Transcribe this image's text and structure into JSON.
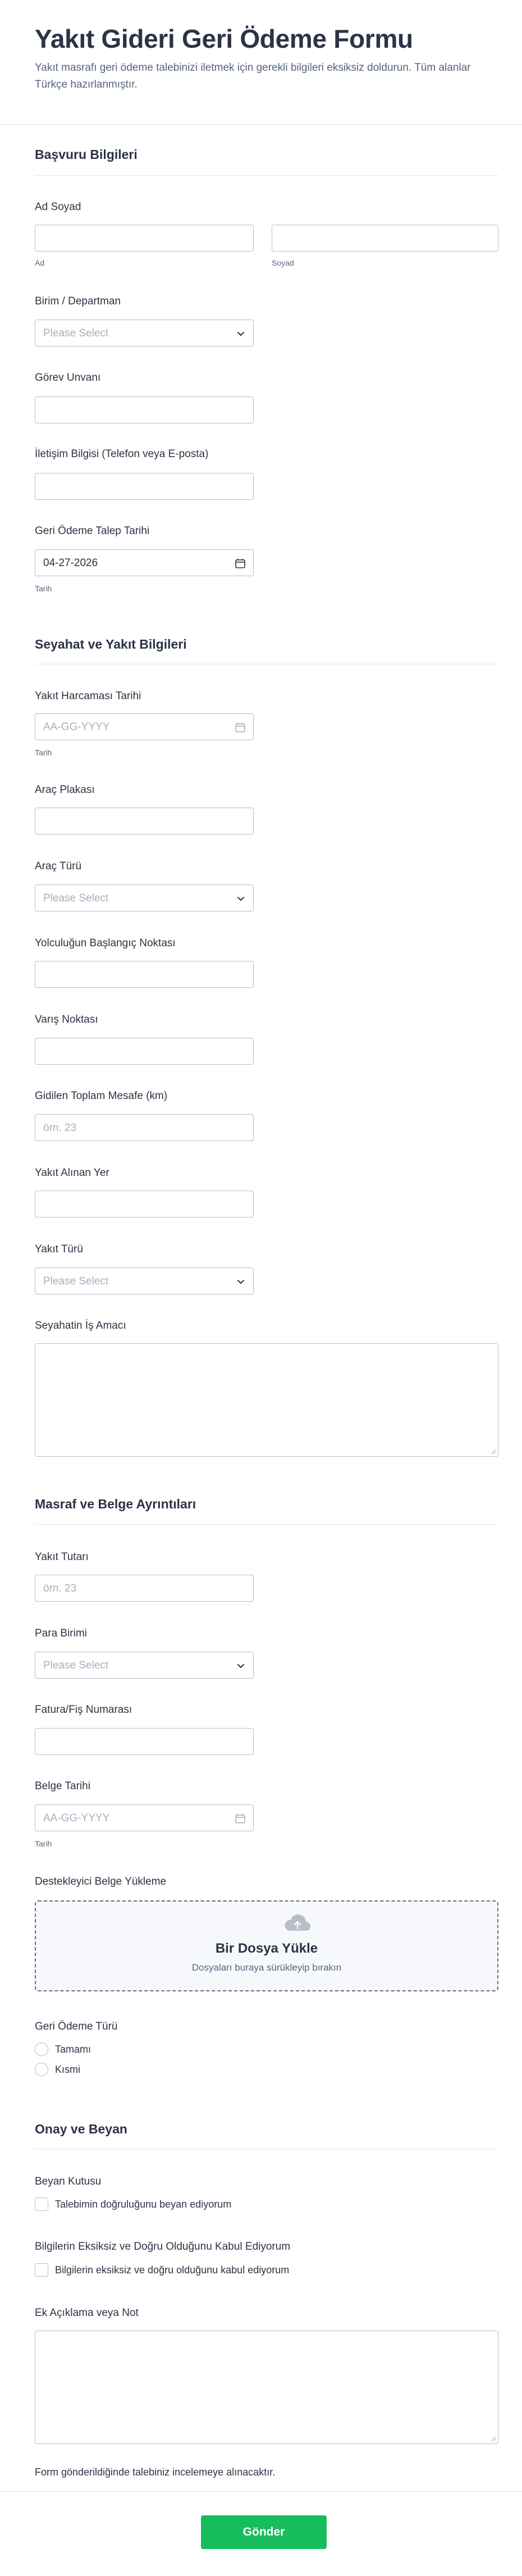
{
  "header": {
    "title": "Yakıt Gideri Geri Ödeme Formu",
    "subtitle": "Yakıt masrafı geri ödeme talebinizi iletmek için gerekli bilgileri eksiksiz doldurun. Tüm alanlar Türkçe hazırlanmıştır."
  },
  "sections": {
    "applicant": "Başvuru Bilgileri",
    "travel": "Seyahat ve Yakıt Bilgileri",
    "expense": "Masraf ve Belge Ayrıntıları",
    "consent": "Onay ve Beyan"
  },
  "fields": {
    "full_name": {
      "label": "Ad Soyad",
      "first_sublabel": "Ad",
      "last_sublabel": "Soyad"
    },
    "department": {
      "label": "Birim / Departman",
      "placeholder": "Please Select"
    },
    "job_title": {
      "label": "Görev Unvanı"
    },
    "contact": {
      "label": "İletişim Bilgisi (Telefon veya E-posta)"
    },
    "request_date": {
      "label": "Geri Ödeme Talep Tarihi",
      "value": "04-27-2026",
      "sublabel": "Tarih"
    },
    "fuel_date": {
      "label": "Yakıt Harcaması Tarihi",
      "placeholder": "AA-GG-YYYY",
      "sublabel": "Tarih"
    },
    "plate": {
      "label": "Araç Plakası"
    },
    "vehicle_type": {
      "label": "Araç Türü",
      "placeholder": "Please Select"
    },
    "start_point": {
      "label": "Yolculuğun Başlangıç Noktası"
    },
    "destination": {
      "label": "Varış Noktası"
    },
    "distance": {
      "label": "Gidilen Toplam Mesafe (km)",
      "placeholder": "örn. 23"
    },
    "fuel_place": {
      "label": "Yakıt Alınan Yer"
    },
    "fuel_type": {
      "label": "Yakıt Türü",
      "placeholder": "Please Select"
    },
    "purpose": {
      "label": "Seyahatin İş Amacı"
    },
    "amount": {
      "label": "Yakıt Tutarı",
      "placeholder": "örn. 23"
    },
    "currency": {
      "label": "Para Birimi",
      "placeholder": "Please Select"
    },
    "invoice_no": {
      "label": "Fatura/Fiş Numarası"
    },
    "doc_date": {
      "label": "Belge Tarihi",
      "placeholder": "AA-GG-YYYY",
      "sublabel": "Tarih"
    },
    "upload": {
      "label": "Destekleyici Belge Yükleme",
      "title": "Bir Dosya Yükle",
      "hint": "Dosyaları buraya sürükleyip bırakın"
    },
    "refund_type": {
      "label": "Geri Ödeme Türü",
      "options": [
        "Tamamı",
        "Kısmi"
      ]
    },
    "declaration": {
      "label": "Beyan Kutusu",
      "option": "Talebimin doğruluğunu beyan ediyorum"
    },
    "accuracy": {
      "label": "Bilgilerin Eksiksiz ve Doğru Olduğunu Kabul Ediyorum",
      "option": "Bilgilerin eksiksiz ve doğru olduğunu kabul ediyorum"
    },
    "notes": {
      "label": "Ek Açıklama veya Not"
    }
  },
  "footer": {
    "note": "Form gönderildiğinde talebiniz incelemeye alınacaktır.",
    "submit_label": "Gönder"
  },
  "colors": {
    "text": "#2c3345",
    "muted": "#57647e",
    "border": "#b8bdc9",
    "submit": "#18bd5b"
  },
  "icons": [
    "chevron-down-icon",
    "calendar-icon",
    "cloud-upload-icon",
    "resize-grip-icon"
  ]
}
